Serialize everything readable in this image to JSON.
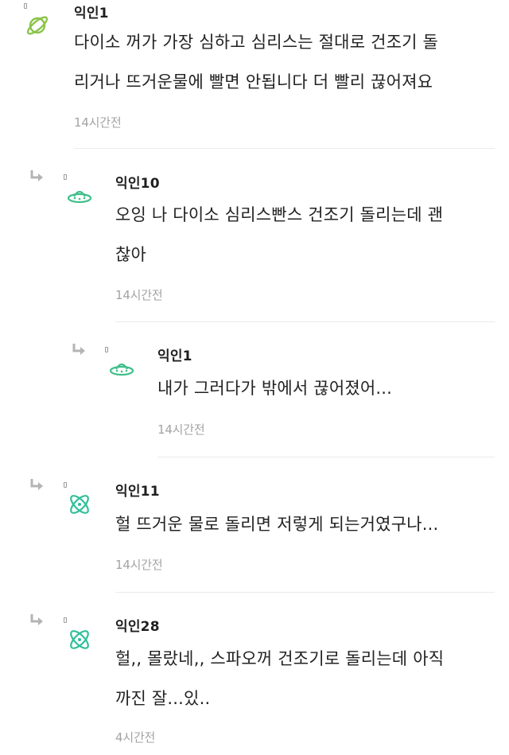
{
  "comments": [
    {
      "author": "익인1",
      "icon": "planet-icon",
      "lines": [
        "다이소 꺼가 가장 심하고 심리스는 절대로 건조기 돌",
        "리거나 뜨거운물에 빨면 안됩니다 더 빨리 끊어져요"
      ],
      "time": "14시간전",
      "depth": 0
    },
    {
      "author": "익인10",
      "icon": "ufo-icon",
      "lines": [
        "오잉 나 다이소 심리스빤스 건조기 돌리는데 괜",
        "찮아"
      ],
      "time": "14시간전",
      "depth": 1
    },
    {
      "author": "익인1",
      "icon": "ufo-icon",
      "lines": [
        "내가 그러다가 밖에서 끊어졌어..."
      ],
      "time": "14시간전",
      "depth": 2
    },
    {
      "author": "익인11",
      "icon": "atom-icon",
      "lines": [
        "헐 뜨거운 물로 돌리면 저렇게 되는거였구나..."
      ],
      "time": "14시간전",
      "depth": 1
    },
    {
      "author": "익인28",
      "icon": "atom-icon",
      "lines": [
        "헐,, 몰랐네,, 스파오꺼 건조기로 돌리는데 아직",
        "까진 잘...있.."
      ],
      "time": "4시간전",
      "depth": 1
    }
  ],
  "colors": {
    "planet": "#8bc34a",
    "ufo": "#3fbf8a",
    "atom": "#2fbf9a",
    "muted": "#a3a3a3"
  }
}
